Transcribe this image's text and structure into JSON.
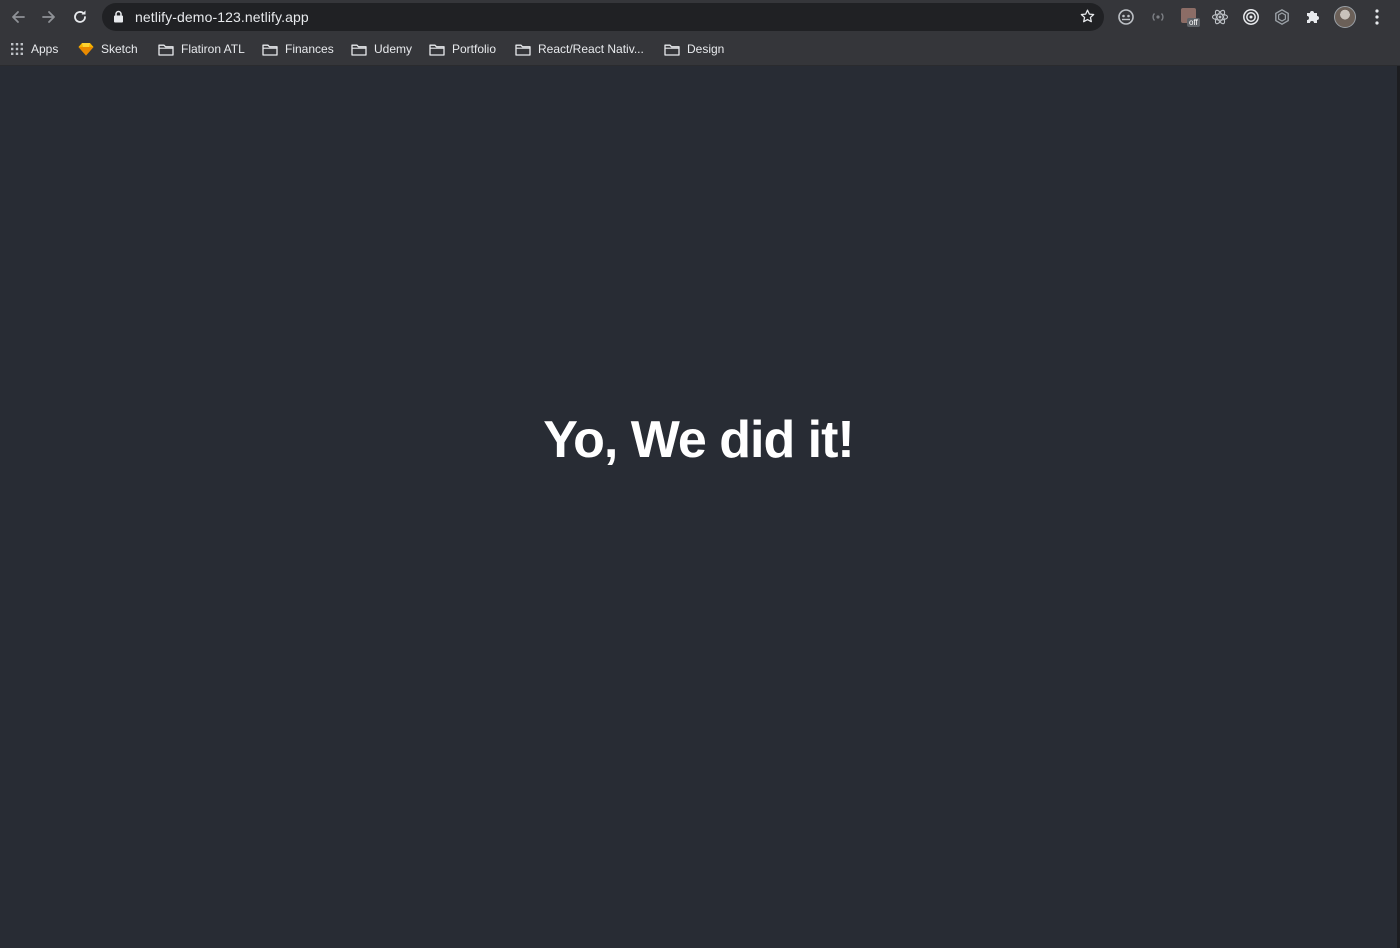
{
  "address_bar": {
    "url": "netlify-demo-123.netlify.app"
  },
  "extensions": {
    "off_badge": "off"
  },
  "bookmarks": [
    {
      "label": "Apps",
      "icon": "apps-grid-icon"
    },
    {
      "label": "Sketch",
      "icon": "sketch-icon"
    },
    {
      "label": "Flatiron ATL",
      "icon": "folder-icon"
    },
    {
      "label": "Finances",
      "icon": "folder-icon"
    },
    {
      "label": "Udemy",
      "icon": "folder-icon"
    },
    {
      "label": "Portfolio",
      "icon": "folder-icon"
    },
    {
      "label": "React/React Nativ...",
      "icon": "folder-icon"
    },
    {
      "label": "Design",
      "icon": "folder-icon"
    }
  ],
  "page": {
    "heading": "Yo, We did it!"
  },
  "colors": {
    "page_background": "#282c34",
    "toolbar_background": "#35363a",
    "omnibox_background": "#202124",
    "heading_text": "#ffffff"
  }
}
